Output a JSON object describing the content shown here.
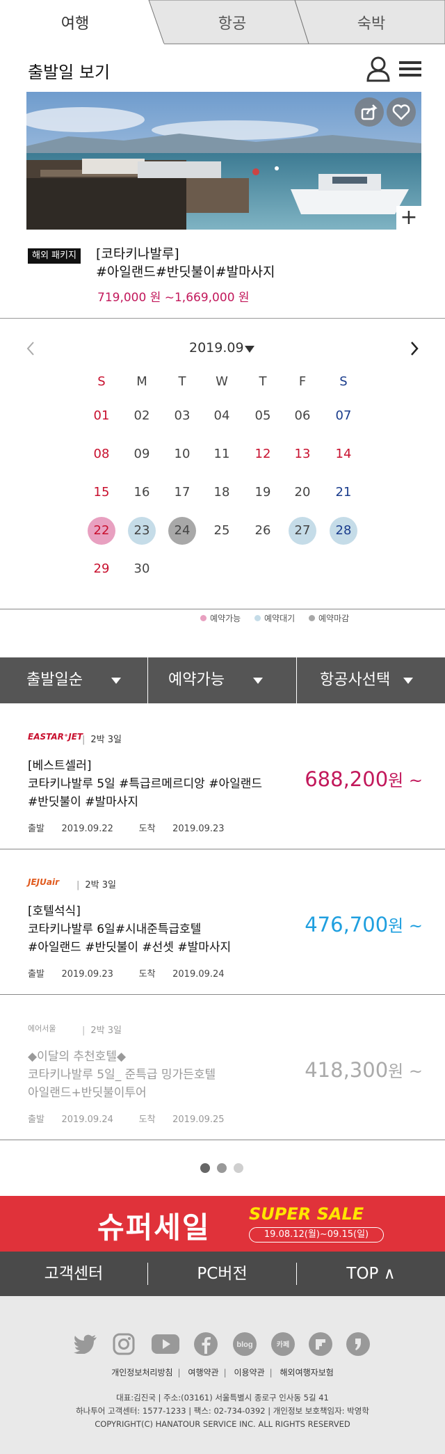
{
  "tabs": [
    {
      "label": "여행"
    },
    {
      "label": "항공"
    },
    {
      "label": "숙박"
    }
  ],
  "header": {
    "title": "출발일 보기"
  },
  "hero": {
    "image": "boat-pier-photo",
    "share_icon": "share-icon",
    "like_icon": "heart-icon",
    "more_label": "+"
  },
  "product": {
    "badge": "해외 패키지",
    "title_line1": "[코타키나발루]",
    "title_line2": "#아일랜드#반딧불이#발마사지",
    "price": "719,000 원 ~1,669,000 원"
  },
  "calendar": {
    "month": "2019.09",
    "weekdays": [
      "S",
      "M",
      "T",
      "W",
      "T",
      "F",
      "S"
    ],
    "weeks": [
      [
        "01",
        "02",
        "03",
        "04",
        "05",
        "06",
        "07"
      ],
      [
        "08",
        "09",
        "10",
        "11",
        "12",
        "13",
        "14"
      ],
      [
        "15",
        "16",
        "17",
        "18",
        "19",
        "20",
        "21"
      ],
      [
        "22",
        "23",
        "24",
        "25",
        "26",
        "27",
        "28"
      ],
      [
        "29",
        "30",
        "",
        "",
        "",
        "",
        ""
      ]
    ],
    "holidays": [
      "12",
      "13",
      "14"
    ],
    "available": [
      "22"
    ],
    "waiting": [
      "23",
      "27",
      "28"
    ],
    "closed": [
      "24"
    ],
    "legend": [
      {
        "label": "예약가능",
        "color": "#e8a0c0"
      },
      {
        "label": "예약대기",
        "color": "#c5dce8"
      },
      {
        "label": "예약마감",
        "color": "#a8a8a8"
      }
    ]
  },
  "filters": [
    {
      "label": "출발일순"
    },
    {
      "label": "예약가능"
    },
    {
      "label": "항공사선택"
    }
  ],
  "items": [
    {
      "airline": "EASTAR⁺JET",
      "nights": "2박 3일",
      "line1": "[베스트셀러]",
      "line2": "코타키나발루 5일 #특급르메르디앙 #아일랜드",
      "line3": "#반딧불이 #발마사지",
      "dates": "출발    2019.09.22      도착    2019.09.23",
      "price": "688,200",
      "unit": "원 ~",
      "color": "#c2185b"
    },
    {
      "airline": "JEJUair",
      "nights": "2박 3일",
      "line1": "[호텔석식]",
      "line2": "코타키나발루 6일#시내준특급호텔",
      "line3": "#아일랜드 #반딧불이 #선셋 #발마사지",
      "dates": "출발    2019.09.23      도착    2019.09.24",
      "price": "476,700",
      "unit": "원 ~",
      "color": "#1f9fdf"
    },
    {
      "airline": "에어서울",
      "nights": "2박 3일",
      "line1": "◆이달의 추천호텔◆",
      "line2": "코타키나발루 5일_ 준특급 밍가든호텔",
      "line3": "아일랜드+반딧불이투어",
      "dates": "출발    2019.09.24      도착    2019.09.25",
      "price": "418,300",
      "unit": "원 ~",
      "color": "#aaaaaa"
    }
  ],
  "banner": {
    "title": "슈퍼세일",
    "english": "SUPER SALE",
    "dates": "19.08.12(월)~09.15(일)"
  },
  "footer_nav": [
    {
      "label": "고객센터"
    },
    {
      "label": "PC버전"
    },
    {
      "label": "TOP ∧"
    }
  ],
  "social": [
    "twitter-icon",
    "instagram-icon",
    "youtube-icon",
    "facebook-icon",
    "blog-icon",
    "cafe-icon",
    "flipboard-icon",
    "kakao-story-icon"
  ],
  "social_labels": {
    "blog": "blog",
    "cafe": "카페"
  },
  "footer_links": [
    "개인정보처리방침",
    "여행약관",
    "이용약관",
    "해외여행자보험"
  ],
  "footer_info": [
    "대표:김진국 | 주소:(03161) 서울특별시 종로구 인사동 5길 41",
    "하나투어 고객센터: 1577-1233 | 팩스: 02-734-0392 | 개인정보 보호책임자: 박영학",
    "COPYRIGHT(C) HANATOUR SERVICE INC. ALL RIGHTS RESERVED"
  ]
}
